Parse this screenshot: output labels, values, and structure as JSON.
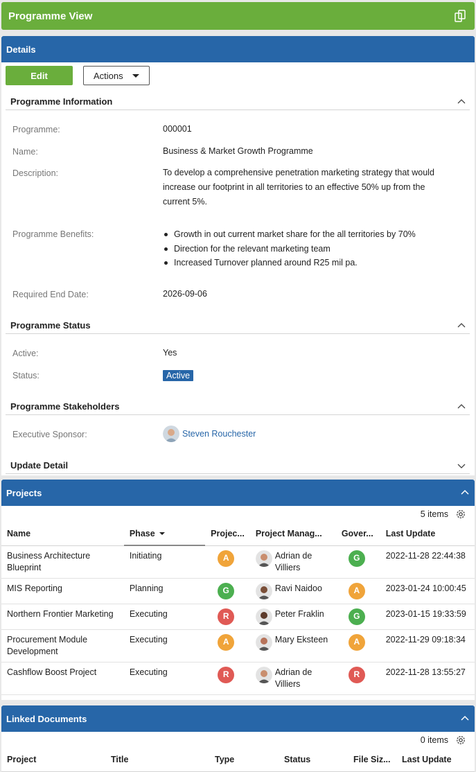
{
  "app": {
    "title": "Programme View"
  },
  "details": {
    "header": "Details",
    "edit_label": "Edit",
    "actions_label": "Actions",
    "info": {
      "title": "Programme Information",
      "programme_label": "Programme:",
      "programme_value": "000001",
      "name_label": "Name:",
      "name_value": "Business & Market Growth Programme",
      "description_label": "Description:",
      "description_value": "To develop a comprehensive penetration marketing strategy that would increase our footprint in all territories to an effective 50% up from the current 5%.",
      "benefits_label": "Programme Benefits:",
      "benefits": [
        "Growth in out current market share for the all territories by 70%",
        "Direction for the relevant marketing team",
        "Increased Turnover planned around R25 mil pa."
      ],
      "end_date_label": "Required End Date:",
      "end_date_value": "2026-09-06"
    },
    "status": {
      "title": "Programme Status",
      "active_label": "Active:",
      "active_value": "Yes",
      "status_label": "Status:",
      "status_value": "Active"
    },
    "stakeholders": {
      "title": "Programme Stakeholders",
      "sponsor_label": "Executive Sponsor:",
      "sponsor_value": "Steven Rouchester"
    },
    "update": {
      "title": "Update Detail"
    }
  },
  "projects": {
    "header": "Projects",
    "count": "5 items",
    "columns": [
      "Name",
      "Phase",
      "Projec...",
      "Project Manag...",
      "Gover...",
      "Last Update"
    ],
    "rows": [
      {
        "name": "Business Architecture Blueprint",
        "phase": "Initiating",
        "project_rag": "A",
        "manager": "Adrian de Villiers",
        "gov_rag": "G",
        "last_update": "2022-11-28 22:44:38"
      },
      {
        "name": "MIS Reporting",
        "phase": "Planning",
        "project_rag": "G",
        "manager": "Ravi Naidoo",
        "gov_rag": "A",
        "last_update": "2023-01-24 10:00:45"
      },
      {
        "name": "Northern Frontier Marketing",
        "phase": "Executing",
        "project_rag": "R",
        "manager": "Peter Fraklin",
        "gov_rag": "G",
        "last_update": "2023-01-15 19:33:59"
      },
      {
        "name": "Procurement Module Development",
        "phase": "Executing",
        "project_rag": "A",
        "manager": "Mary Eksteen",
        "gov_rag": "A",
        "last_update": "2022-11-29 09:18:34"
      },
      {
        "name": "Cashflow Boost Project",
        "phase": "Executing",
        "project_rag": "R",
        "manager": "Adrian de Villiers",
        "gov_rag": "R",
        "last_update": "2022-11-28 13:55:27"
      }
    ]
  },
  "documents": {
    "header": "Linked Documents",
    "count": "0 items",
    "columns": [
      "Project",
      "Title",
      "Type",
      "Status",
      "File Siz...",
      "Last Update"
    ]
  },
  "colors": {
    "green_bar": "#6aae3c",
    "blue_header": "#2766a8",
    "rag_A": "#f0a43a",
    "rag_G": "#4caf50",
    "rag_R": "#e05a55"
  }
}
